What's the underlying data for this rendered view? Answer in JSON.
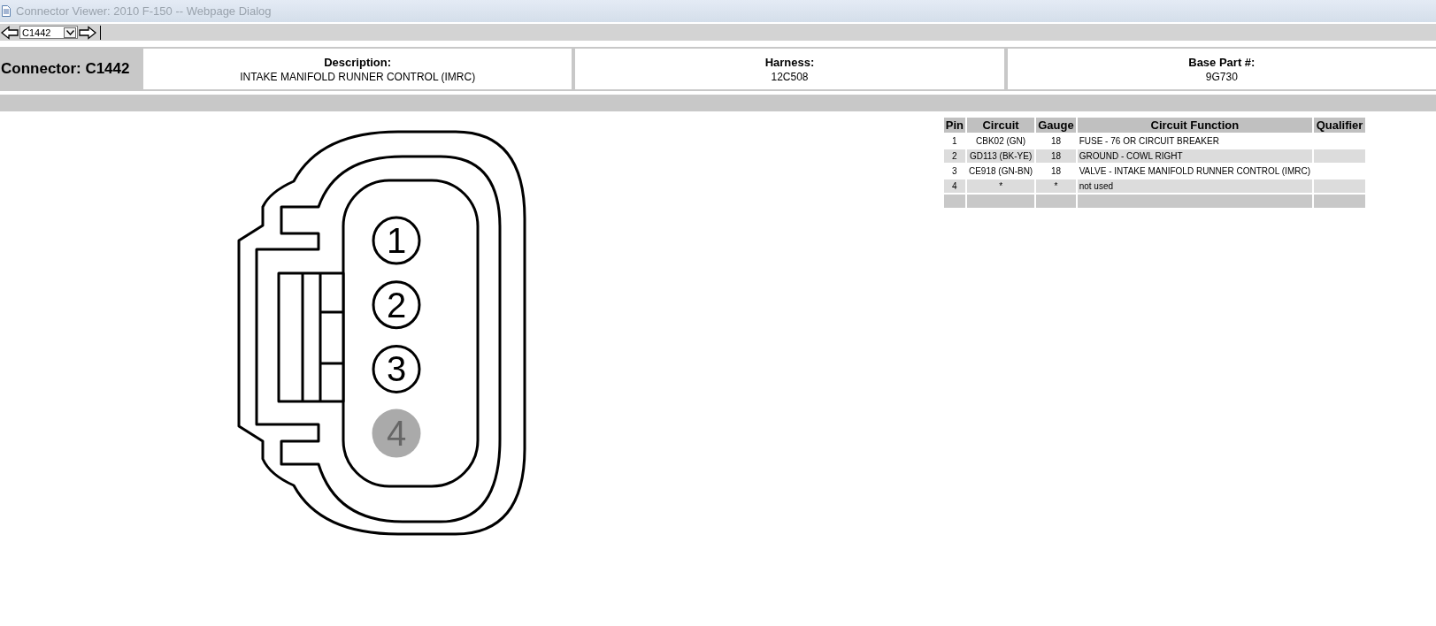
{
  "window": {
    "title": "Connector Viewer: 2010 F-150 -- Webpage Dialog"
  },
  "toolbar": {
    "connector_select": {
      "value": "C1442"
    }
  },
  "header": {
    "connector_label": "Connector: C1442",
    "fields": [
      {
        "label": "Description:",
        "value": "INTAKE MANIFOLD RUNNER CONTROL (IMRC)"
      },
      {
        "label": "Harness:",
        "value": "12C508"
      },
      {
        "label": "Base Part #:",
        "value": "9G730"
      }
    ]
  },
  "diagram": {
    "pins": [
      {
        "label": "1",
        "used": true
      },
      {
        "label": "2",
        "used": true
      },
      {
        "label": "3",
        "used": true
      },
      {
        "label": "4",
        "used": false
      }
    ]
  },
  "pin_table": {
    "columns": [
      "Pin",
      "Circuit",
      "Gauge",
      "Circuit Function",
      "Qualifier"
    ],
    "rows": [
      {
        "pin": "1",
        "circuit": "CBK02 (GN)",
        "gauge": "18",
        "function": "FUSE - 76 OR CIRCUIT BREAKER"
      },
      {
        "pin": "2",
        "circuit": "GD113 (BK-YE)",
        "gauge": "18",
        "function": "GROUND - COWL RIGHT"
      },
      {
        "pin": "3",
        "circuit": "CE918 (GN-BN)",
        "gauge": "18",
        "function": "VALVE - INTAKE MANIFOLD RUNNER CONTROL (IMRC)"
      },
      {
        "pin": "4",
        "circuit": "*",
        "gauge": "*",
        "function": "not used"
      }
    ]
  }
}
